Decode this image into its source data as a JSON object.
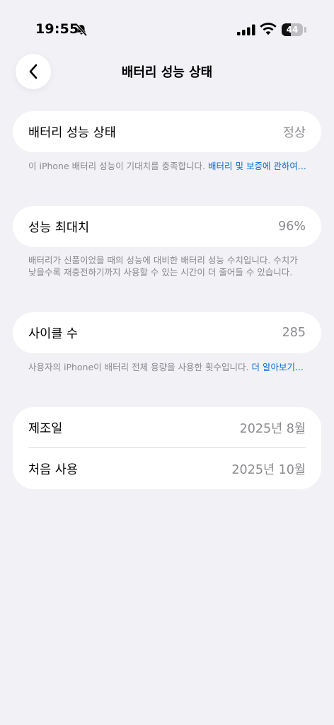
{
  "status_bar": {
    "time": "19:55",
    "battery_level": "44"
  },
  "nav": {
    "title": "배터리 성능 상태"
  },
  "battery_health": {
    "label": "배터리 성능 상태",
    "value": "정상",
    "note": "이 iPhone 배터리 성능이 기대치를 충족합니다. ",
    "note_link": "배터리 및 보증에 관하여..."
  },
  "max_capacity": {
    "label": "성능 최대치",
    "value": "96%",
    "note": "배터리가 신품이었을 때의 성능에 대비한 배터리 성능 수치입니다. 수치가 낮을수록 재충전하기까지 사용할 수 있는 시간이 더 줄어들 수 있습니다."
  },
  "cycle_count": {
    "label": "사이클 수",
    "value": "285",
    "note": "사용자의 iPhone이 배터리 전체 용량을 사용한 횟수입니다. ",
    "note_link": "더 알아보기..."
  },
  "dates": {
    "manufacture_label": "제조일",
    "manufacture_value": "2025년 8월",
    "first_use_label": "처음 사용",
    "first_use_value": "2025년 10월"
  }
}
